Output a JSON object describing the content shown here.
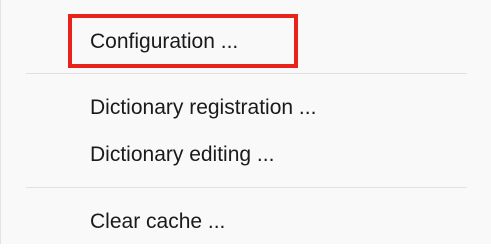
{
  "menu": {
    "items": [
      {
        "label": "Configuration ..."
      },
      {
        "label": "Dictionary registration ..."
      },
      {
        "label": "Dictionary editing ..."
      },
      {
        "label": "Clear cache ..."
      }
    ]
  },
  "colors": {
    "menu_background": "#f9f9f9",
    "text": "#1a1a1a",
    "separator": "#e1e1e1",
    "highlight_border": "#e8231c"
  }
}
